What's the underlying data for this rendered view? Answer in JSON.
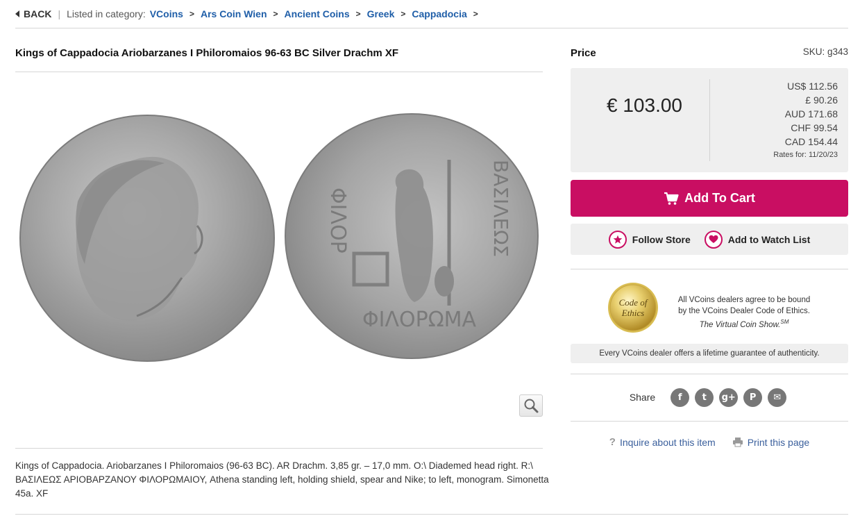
{
  "breadcrumb": {
    "back": "BACK",
    "listed": "Listed in category:",
    "items": [
      "VCoins",
      "Ars Coin Wien",
      "Ancient Coins",
      "Greek",
      "Cappadocia"
    ],
    "arrow": ">"
  },
  "item": {
    "title": "Kings of Cappadocia Ariobarzanes I Philoromaios 96-63 BC Silver Drachm XF",
    "description": "Kings of Cappadocia. Ariobarzanes I Philoromaios (96-63 BC). AR Drachm. 3,85 gr. – 17,0 mm. O:\\ Diademed head right. R:\\ ΒΑΣΙΛΕΩΣ ΑΡΙΟΒΑΡΖΑΝΟΥ ΦΙΛΟΡΩΜΑΙΟΥ, Athena standing left, holding shield, spear and Nike; to left, monogram. Simonetta 45a. XF"
  },
  "price": {
    "label": "Price",
    "sku": "SKU: g343",
    "main": "€ 103.00",
    "rates": [
      "US$ 112.56",
      "£ 90.26",
      "AUD 171.68",
      "CHF 99.54",
      "CAD 154.44"
    ],
    "rates_date": "Rates for: 11/20/23"
  },
  "actions": {
    "add_to_cart": "Add To Cart",
    "follow_store": "Follow Store",
    "watch_list": "Add to Watch List"
  },
  "ethics": {
    "seal_line1": "Code of",
    "seal_line2": "Ethics",
    "line1": "All VCoins dealers agree to be bound",
    "line2": "by the VCoins Dealer Code of Ethics.",
    "line3": "The Virtual Coin Show.",
    "sup": "SM",
    "guarantee": "Every VCoins dealer offers a lifetime guarantee of authenticity."
  },
  "share": {
    "label": "Share",
    "icons": [
      "f",
      "t",
      "g+",
      "P",
      "✉"
    ]
  },
  "links": {
    "inquire": "Inquire about this item",
    "print": "Print this page"
  },
  "colors": {
    "accent": "#c90e62",
    "link": "#1f5ea8",
    "panel": "#efefef"
  }
}
